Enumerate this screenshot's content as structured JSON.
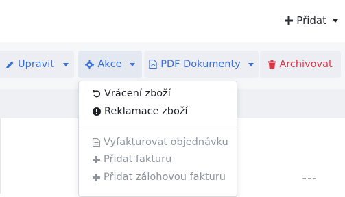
{
  "header": {
    "add_label": "Přidat"
  },
  "toolbar": {
    "edit_label": "Upravit",
    "actions_label": "Akce",
    "pdf_label": "PDF Dokumenty",
    "archive_label": "Archivovat"
  },
  "actions_menu": {
    "items": [
      {
        "label": "Vrácení zboží",
        "icon": "undo-icon"
      },
      {
        "label": "Reklamace zboží",
        "icon": "exclamation-circle-icon"
      },
      {
        "label": "Vyfakturovat objednávku",
        "icon": "document-icon"
      },
      {
        "label": "Přidat fakturu",
        "icon": "plus-icon"
      },
      {
        "label": "Přidat zálohovou fakturu",
        "icon": "plus-icon"
      }
    ]
  },
  "content": {
    "placeholder_value": "---"
  },
  "colors": {
    "accent_blue": "#3a6fd6",
    "danger_red": "#d93545",
    "muted_gray": "#8e939c"
  }
}
